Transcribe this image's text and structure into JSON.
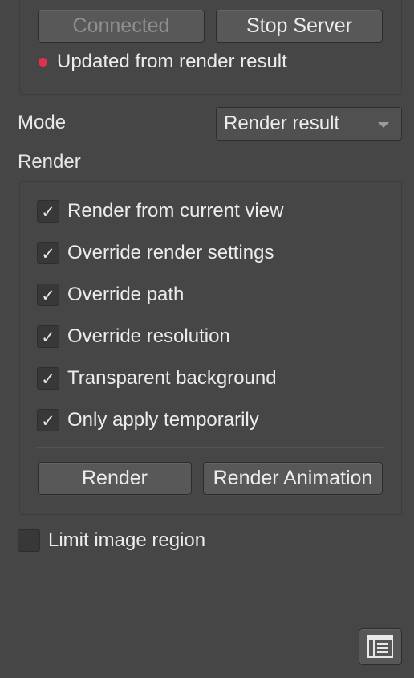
{
  "connection": {
    "connect_label": "Connected",
    "stop_label": "Stop Server",
    "status_text": "Updated from render result",
    "status_color": "#e0324a"
  },
  "mode": {
    "label": "Mode",
    "selected": "Render result"
  },
  "render": {
    "section_label": "Render",
    "options": [
      {
        "label": "Render from current view",
        "checked": true
      },
      {
        "label": "Override render settings",
        "checked": true
      },
      {
        "label": "Override path",
        "checked": true
      },
      {
        "label": "Override resolution",
        "checked": true
      },
      {
        "label": "Transparent background",
        "checked": true
      },
      {
        "label": "Only apply temporarily",
        "checked": true
      }
    ],
    "render_button": "Render",
    "render_animation_button": "Render Animation"
  },
  "limit_region": {
    "label": "Limit image region",
    "checked": false
  },
  "footer": {
    "panel_icon": "panel-toggle-icon"
  }
}
